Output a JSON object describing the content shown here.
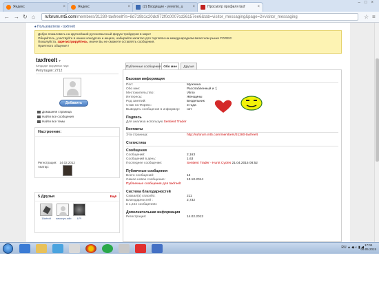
{
  "browser": {
    "tabs": [
      {
        "label": "Яндекс"
      },
      {
        "label": "Яндекс"
      },
      {
        "label": "(2) Входящие - yevenio_u"
      },
      {
        "label": "Просмотр профиля taxf"
      }
    ],
    "url_host": "ruforum.mt5.com",
    "url_path": "/members/31280-taxfreelt?s=8d719b1c20dc972f0c0007cd36157ee6&tab=visitor_messaging&page=2#visitor_messaging"
  },
  "breadcrumb": {
    "first": "Пользователи",
    "second": "taxfreelt"
  },
  "notice": {
    "line1": "Добро пожаловать на крупнейший русскоязычный форум трейдеров в мире!",
    "line2": "Общайтесь, участвуйте в наших конкурсах и акциях, набирайте капитал для торговли на международном валютном рынке FOREX!",
    "line3_before": "Пожалуйста, ",
    "line3_link": "зарегистрируйтесь",
    "line3_after": ", иначе Вы не сможете оставлять сообщения.",
    "line4": "Приятного общения !"
  },
  "profile": {
    "username": "taxfreelt",
    "usertitle": "Кандидат форумных наук",
    "reputation": "Репутация: 2712",
    "add_friend": "Добавить",
    "links": [
      "Домашняя страница",
      "Найти все сообщения",
      "Найти все темы"
    ],
    "mood_title": "Настроение:",
    "reg_label": "Регистрация:",
    "reg_date": "14.02.2012",
    "avatar_label": "Аватар:",
    "friends_title": "5 Друзья",
    "friends_all": "Ещё",
    "friends": [
      {
        "name": "1Astrolt"
      },
      {
        "name": "savanyu.sdb"
      },
      {
        "name": "LPI"
      }
    ]
  },
  "tabs": [
    "Публичные сообщения",
    "Обо мне",
    "Друзья"
  ],
  "basic_info": {
    "title": "Базовая информация",
    "rows": [
      {
        "label": "Пол:",
        "value": "Мужчина"
      },
      {
        "label": "Обо мне:",
        "value": "Расслабленный и :("
      },
      {
        "label": "Местожительство:",
        "value": "Vilnio"
      },
      {
        "label": "Интересы:",
        "value": "Женщины"
      },
      {
        "label": "Род занятий:",
        "value": "Бездельник"
      },
      {
        "label": "Стаж на Форекс:",
        "value": "3 года"
      },
      {
        "label": "Выводить сообщения в информер:",
        "value": "нет"
      }
    ]
  },
  "signature": {
    "title": "Подпись",
    "text_before": "Для анализа использую ",
    "text_link": "Sentient Trader"
  },
  "contacts": {
    "title": "Контакты",
    "label": "Эта страница:",
    "value": "http://ruforum.mt5.com/members/31280-taxfreelt"
  },
  "stats": {
    "title": "Статистика",
    "messages_title": "Сообщения",
    "rows": [
      {
        "label": "Сообщений:",
        "value": "2,163"
      },
      {
        "label": "Сообщений в день:",
        "value": "1.63"
      },
      {
        "label": "Последнее сообщение:",
        "value_link": "Sentient Trader - Hurst Cycles",
        "value_rest": "21.04.2015 08:52"
      }
    ],
    "public_title": "Публичные сообщения",
    "public_rows": [
      {
        "label": "Всего сообщений:",
        "value": "12"
      },
      {
        "label": "Самое новое сообщение:",
        "value": "13.10.2014"
      }
    ],
    "public_link": "Публичные сообщения для taxfreelt",
    "thanks_title": "Система благодарностей",
    "thanks_rows": [
      {
        "label": "Сказал(а) спасибо:",
        "value": "211"
      },
      {
        "label": "Благодарностей :",
        "value": "2,732"
      },
      {
        "label": "в 1,244 сообщениях",
        "value": ""
      }
    ],
    "extra_title": "Дополнительная информация",
    "extra_rows": [
      {
        "label": "Регистрация:",
        "value": "14.02.2012"
      }
    ]
  },
  "taskbar": {
    "tray_lang": "RU",
    "time": "17:04",
    "date": "09.05.2015"
  }
}
